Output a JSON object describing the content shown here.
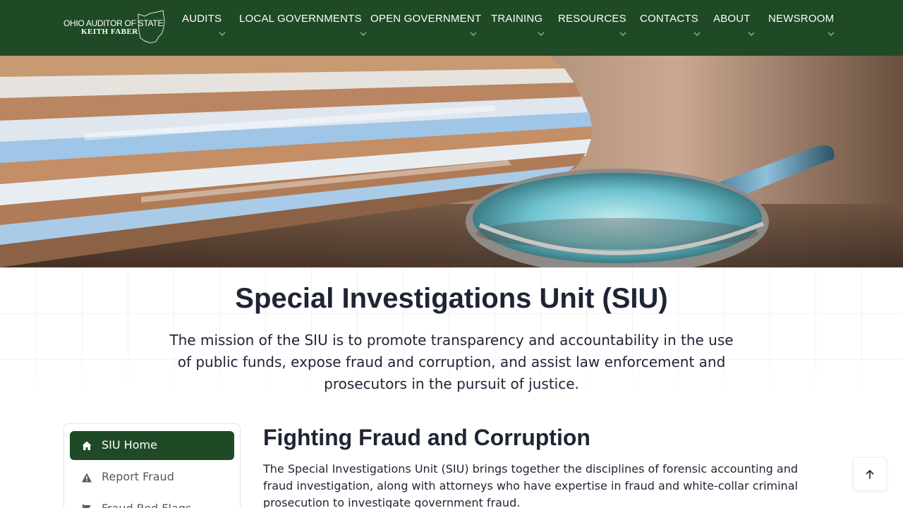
{
  "header": {
    "logo": {
      "line1": "OHIO AUDITOR OF STATE",
      "line2": "KEITH FABER"
    },
    "nav": [
      {
        "label": "AUDITS"
      },
      {
        "label": "LOCAL GOVERNMENTS"
      },
      {
        "label": "OPEN GOVERNMENT"
      },
      {
        "label": "TRAINING"
      },
      {
        "label": "RESOURCES"
      },
      {
        "label": "CONTACTS"
      },
      {
        "label": "ABOUT"
      },
      {
        "label": "NEWSROOM"
      }
    ]
  },
  "hero": {
    "title": "Special Investigations Unit (SIU)",
    "mission": "The mission of the SIU is to promote transparency and accountability in the use of public funds, expose fraud and corruption, and assist law enforcement and prosecutors in the pursuit of justice."
  },
  "sidebar": {
    "items": [
      {
        "label": "SIU Home",
        "icon": "home-icon",
        "active": true
      },
      {
        "label": "Report Fraud",
        "icon": "warning-icon"
      },
      {
        "label": "Fraud Red Flags",
        "icon": "flag-icon"
      }
    ]
  },
  "main": {
    "heading": "Fighting Fraud and Corruption",
    "paragraph": "The Special Investigations Unit (SIU) brings together the disciplines of forensic accounting and fraud investigation, along with attorneys who have expertise in fraud and white-collar criminal prosecution to investigate government fraud."
  },
  "colors": {
    "brand_green": "#1f4a25",
    "text": "#1e2434",
    "sidebar_text": "#555c66"
  },
  "back_to_top": {
    "icon": "arrow-up-icon"
  }
}
